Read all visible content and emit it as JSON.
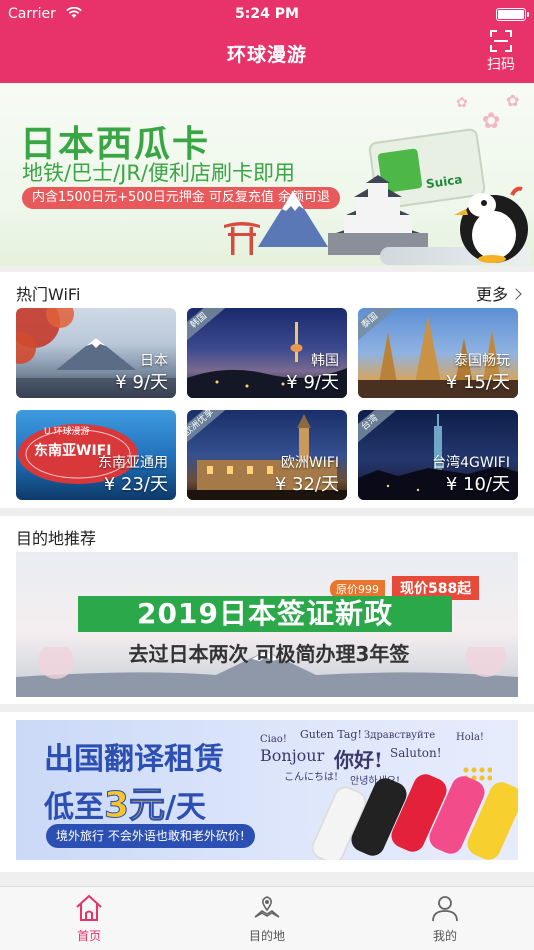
{
  "status_bar": {
    "carrier": "Carrier",
    "time": "5:24 PM"
  },
  "nav": {
    "title": "环球漫游",
    "scan_label": "扫码"
  },
  "top_banner": {
    "title": "日本西瓜卡",
    "subtitle": "地铁/巴士/JR/便利店刷卡即用",
    "pill": "内含1500日元+500日元押金 可反复充值 余额可退",
    "card_text": "Suica"
  },
  "wifi": {
    "heading": "热门WiFi",
    "more_label": "更多",
    "tiles": [
      {
        "name": "日本",
        "price": "¥ 9/天",
        "corner": ""
      },
      {
        "name": "韩国",
        "price": "¥ 9/天",
        "corner": "韩国"
      },
      {
        "name": "泰国畅玩",
        "price": "¥ 15/天",
        "corner": "泰国"
      },
      {
        "name": "东南亚通用",
        "price": "¥ 23/天",
        "corner": "",
        "sign": "东南亚WIFI",
        "brand": "U 环球漫游"
      },
      {
        "name": "欧洲WIFI",
        "price": "¥ 32/天",
        "corner": "欧洲优享"
      },
      {
        "name": "台湾4GWIFI",
        "price": "¥ 10/天",
        "corner": "台湾"
      }
    ]
  },
  "destination": {
    "heading": "目的地推荐",
    "visa_banner": {
      "old_price": "原价999",
      "now_price": "现价588起",
      "title": "2019日本签证新政",
      "subtitle": "去过日本两次 可极简办理3年签"
    }
  },
  "translator_banner": {
    "title": "出国翻译租赁",
    "price_prefix": "低至",
    "price_value": "3元",
    "price_suffix": "/天",
    "slogan": "境外旅行 不会外语也敢和老外砍价!",
    "greetings": [
      "Ciao!",
      "Guten Tag!",
      "Здравствуйте",
      "Hola!",
      "Bonjour",
      "你好!",
      "Saluton!",
      "こんにちは!",
      "안녕하세요!"
    ]
  },
  "tabbar": {
    "items": [
      {
        "label": "首页",
        "icon": "home-icon",
        "active": true
      },
      {
        "label": "目的地",
        "icon": "map-book-icon",
        "active": false
      },
      {
        "label": "我的",
        "icon": "user-icon",
        "active": false
      }
    ]
  },
  "colors": {
    "brand": "#e8336a",
    "suica_green": "#3aa544",
    "translator_blue": "#2b4fb2"
  }
}
